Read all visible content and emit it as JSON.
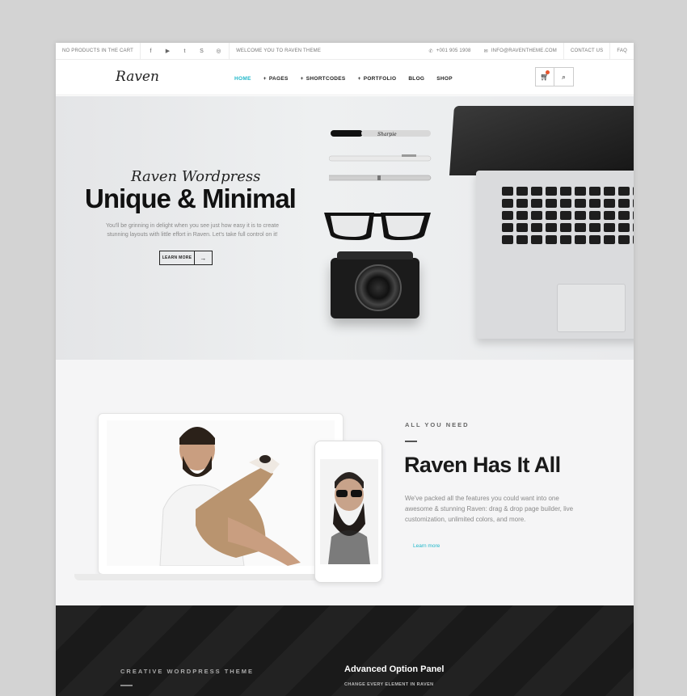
{
  "topbar": {
    "cart_text": "NO PRODUCTS IN THE CART",
    "social": [
      {
        "icon": "facebook-icon",
        "glyph": "f"
      },
      {
        "icon": "youtube-icon",
        "glyph": "▶"
      },
      {
        "icon": "twitter-icon",
        "glyph": "t"
      },
      {
        "icon": "skype-icon",
        "glyph": "S"
      },
      {
        "icon": "instagram-icon",
        "glyph": "◎"
      }
    ],
    "welcome": "WELCOME YOU TO RAVEN THEME",
    "phone": "+001 905 1908",
    "email": "INFO@RAVENTHEME.COM",
    "contact": "CONTACT US",
    "faq": "FAQ"
  },
  "nav": {
    "logo": "Raven",
    "items": [
      {
        "label": "HOME",
        "plus": false,
        "active": true
      },
      {
        "label": "PAGES",
        "plus": true,
        "active": false
      },
      {
        "label": "SHORTCODES",
        "plus": true,
        "active": false
      },
      {
        "label": "PORTFOLIO",
        "plus": true,
        "active": false
      },
      {
        "label": "BLOG",
        "plus": false,
        "active": false
      },
      {
        "label": "SHOP",
        "plus": false,
        "active": false
      }
    ],
    "accent": "#1fb7c9"
  },
  "hero": {
    "script": "Raven Wordpress",
    "title": "Unique & Minimal",
    "description": "You'll be grinning in delight when you see just how easy it is to create stunning layouts with little effort in Raven. Let's take full control on it!",
    "button": "LEARN MORE",
    "arrow": "→"
  },
  "features": {
    "kicker": "ALL YOU NEED",
    "title": "Raven Has It All",
    "description": "We've packed all the features you could want into one awesome & stunning Raven: drag & drop page builder, live customization, unlimited colors, and more.",
    "link": "Learn more"
  },
  "dark": {
    "kicker": "CREATIVE WORDPRESS THEME",
    "heading": "Advanced Option Panel",
    "subheading": "CHANGE EVERY ELEMENT IN RAVEN"
  }
}
